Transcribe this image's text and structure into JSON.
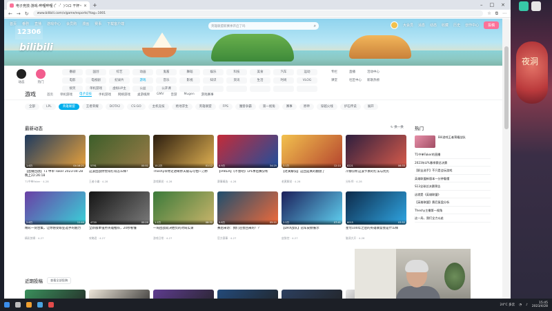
{
  "browser": {
    "tab_title": "电子竞技:游戏-哔哩哔哩 (゜-゜)つロ 干杯~-bilibili",
    "url": "www.bilibili.com/v/game/esports/?tag=1001"
  },
  "stream": {
    "overlay_text": "12306",
    "right_deco_text": "夜洞"
  },
  "header": {
    "nav": [
      "首页",
      "番剧",
      "直播",
      "游戏中心",
      "会员购",
      "漫画",
      "赛事",
      "下载客户端"
    ],
    "logo": "bilibili",
    "search_placeholder": "英雄联盟新赛季开启了吗",
    "right_nav": [
      "大会员",
      "消息",
      "动态",
      "收藏",
      "历史",
      "创作中心",
      "投稿"
    ]
  },
  "channels": {
    "icons": [
      {
        "label": "动态",
        "color": "#222222"
      },
      {
        "label": "热门",
        "color": "#f25d8e"
      }
    ],
    "grid": [
      "番剧",
      "国创",
      "综艺",
      "动画",
      "鬼畜",
      "舞蹈",
      "娱乐",
      "科技",
      "美食",
      "汽车",
      "运动",
      "电影",
      "电视剧",
      "纪录片",
      "游戏",
      "音乐",
      "影视",
      "知识",
      "资讯",
      "生活",
      "时尚",
      "VLOG",
      "搞笑",
      "单机游戏",
      "虚拟UP主",
      "公益",
      "公开课",
      "",
      "",
      "",
      "",
      "",
      ""
    ],
    "active": "游戏",
    "side": [
      "专栏",
      "直播",
      "活动中心",
      "课堂",
      "社区中心",
      "新歌热榜"
    ]
  },
  "game": {
    "title": "游戏",
    "tabs": [
      "首页",
      "单机游戏",
      "电子竞技",
      "手机游戏",
      "网络游戏",
      "桌游棋牌",
      "GMV",
      "音游",
      "Mugen",
      "游戏赛事"
    ],
    "active_tab": "电子竞技",
    "tags": [
      "全部",
      "LPL",
      "英雄联盟",
      "王者荣耀",
      "DOTA2",
      "CS:GO",
      "主机竞技",
      "绝地求生",
      "英雄联盟",
      "FPS",
      "魔兽争霸",
      "第一视角",
      "赛事",
      "原神",
      "穿越火线",
      "炉石传说",
      "展开"
    ],
    "active_tag": "英雄联盟"
  },
  "recent": {
    "title": "最新动态",
    "control": "换一换",
    "videos": [
      {
        "title": "【直播回放】T1 中单 Faker 2023-04-28 晚上22:26:18",
        "stat": "1.6万",
        "dur": "04:16:21",
        "meta": "T1中单Faker · 4-28",
        "c1": "#1e3a5f",
        "c2": "#e8a23c"
      },
      {
        "title": "这波团战你觉得打得怎么样？",
        "stat": "5791",
        "dur": "00:51",
        "meta": "王者小编 · 4-28",
        "c1": "#3c5e2a",
        "c2": "#9a7b47"
      },
      {
        "title": "Theshy带你走进奇妙天赋与可怕一刀秒",
        "stat": "10.2万",
        "dur": "01:12",
        "meta": "游戏解说 · 4-28",
        "c1": "#2b1d0f",
        "c2": "#e0b152"
      },
      {
        "title": "【FAKER】《不会吧》LPL季后赛分析",
        "stat": "6.9万",
        "dur": "34:25",
        "meta": "赛事精选 · 4-28",
        "c1": "#c42b38",
        "c2": "#1f4f9d"
      },
      {
        "title": "【老黄解说】这回是真的翻盘了",
        "stat": "3.1万",
        "dur": "12:10",
        "meta": "老黄解说 · 4-28",
        "c1": "#f2c14e",
        "c2": "#b5442e"
      },
      {
        "title": "冷静分析这波节奏的打法与优劣",
        "stat": "8221",
        "dur": "06:33",
        "meta": "分析师 · 4-28",
        "c1": "#2e1f3e",
        "c2": "#d85b4b"
      },
      {
        "title": "精彩一刻合集，让你感受职业选手的魅力",
        "stat": "2.6万",
        "dur": "11:44",
        "meta": "精彩剪辑 · 4-27",
        "c1": "#6a3fa5",
        "c2": "#3ad1d8"
      },
      {
        "title": "全新版本强势英雄推荐，20秒看懂",
        "stat": "4720",
        "dur": "00:20",
        "meta": "攻略君 · 4-27",
        "c1": "#151515",
        "c2": "#7a7a7a"
      },
      {
        "title": "一局团战就决胜负的对局实录",
        "stat": "1.2万",
        "dur": "08:32",
        "meta": "游戏日常 · 4-27",
        "c1": "#3b7a3a",
        "c2": "#c9b46a"
      },
      {
        "title": "赛后采访：我们还会回来的！？",
        "stat": "9.8万",
        "dur": "05:11",
        "meta": "官方赛事 · 4-27",
        "c1": "#1e4e6e",
        "c2": "#f06a3a"
      },
      {
        "title": "【DRX战队】冠军皮肤展示",
        "stat": "2.2万",
        "dur": "07:41",
        "meta": "皮肤控 · 4-27",
        "c1": "#1c1f5a",
        "c2": "#5fd0f0"
      },
      {
        "title": "星穹100年之后的英雄联盟会是什么样",
        "stat": "6015",
        "dur": "03:52",
        "meta": "脑洞大开 · 4-26",
        "c1": "#0d2a4a",
        "c2": "#2fa6e3"
      }
    ]
  },
  "hot": {
    "title": "热门",
    "first": "Bili游戏王者荣耀战队",
    "items": [
      "T1中单Faker的直播",
      "2023年LPL春季赛总决赛",
      "【职业选手】不只是会玩游戏",
      "英雄联盟新版本一分钟看懂",
      "S13全球总决赛预告",
      "这就是《英雄联盟》",
      "【英雄联盟】赛后复盘分析",
      "Theshy主播第一视角",
      "这一局，我们全力以赴"
    ]
  },
  "near": {
    "title": "近期投稿",
    "button": "查看全部投稿",
    "colors": [
      "#3a8f5c",
      "#ece5d8",
      "#5e3c8f",
      "#234a7a",
      "#2c3f5f",
      "#e8e8e8"
    ]
  },
  "taskbar": {
    "weather": "24°C 多云",
    "time": "15:45",
    "date": "2023/4/28"
  }
}
